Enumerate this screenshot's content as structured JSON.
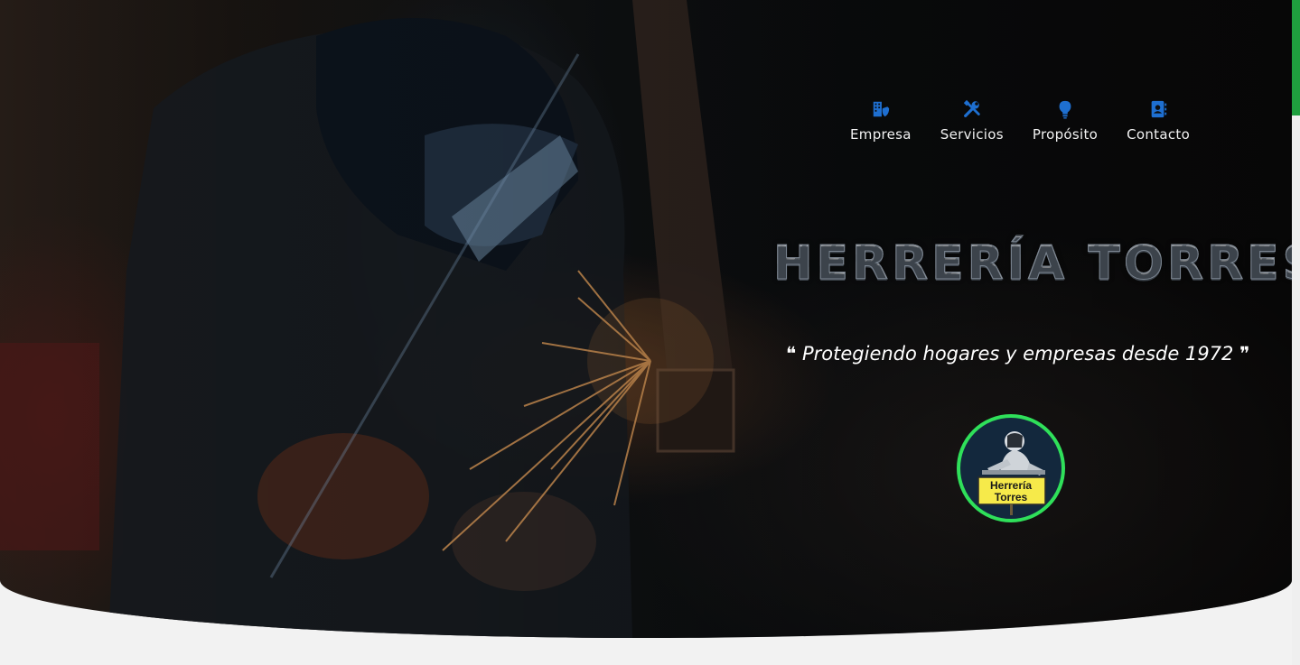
{
  "nav": {
    "items": [
      {
        "label": "Empresa",
        "icon": "building-shield-icon"
      },
      {
        "label": "Servicios",
        "icon": "tools-icon"
      },
      {
        "label": "Propósito",
        "icon": "lightbulb-icon"
      },
      {
        "label": "Contacto",
        "icon": "contact-book-icon"
      }
    ],
    "icon_color": "#1e6fd0"
  },
  "hero": {
    "title": "HERRERÍA TORRES",
    "tagline": "❝ Protegiendo hogares y empresas desde 1972 ❞"
  },
  "logo": {
    "line1": "Herrería",
    "line2": "Torres",
    "ring_color": "#2fe05a",
    "sign_color": "#f6ea4a"
  },
  "colors": {
    "accent": "#1f9f3e",
    "page_background": "#f2f2f2"
  }
}
